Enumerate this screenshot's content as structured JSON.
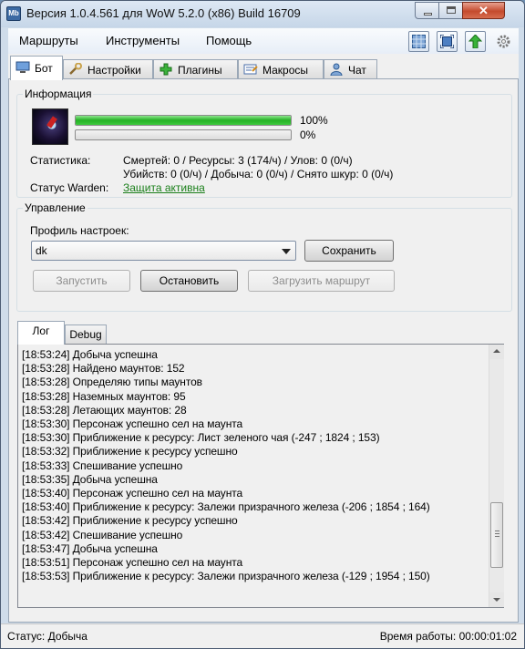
{
  "window": {
    "title": "Версия 1.0.4.561 для WoW 5.2.0 (x86) Build 16709",
    "app_icon_text": "Mb",
    "close_glyph": "✕"
  },
  "menu": {
    "items": [
      "Маршруты",
      "Инструменты",
      "Помощь"
    ],
    "toolbar_icons": [
      "grid-icon",
      "fullscreen-icon",
      "arrow-up-icon",
      "gear-icon"
    ]
  },
  "tabs": [
    {
      "label": "Бот",
      "icon": "monitor-icon",
      "active": true
    },
    {
      "label": "Настройки",
      "icon": "wrench-icon",
      "active": false
    },
    {
      "label": "Плагины",
      "icon": "plus-icon",
      "active": false
    },
    {
      "label": "Макросы",
      "icon": "macro-icon",
      "active": false
    },
    {
      "label": "Чат",
      "icon": "user-icon",
      "active": false
    }
  ],
  "info": {
    "title": "Информация",
    "bar1_value": 100,
    "bar1_label": "100%",
    "bar2_value": 0,
    "bar2_label": "0%",
    "stats_label": "Статистика:",
    "stats_line1": "Смертей: 0 / Ресурсы: 3 (174/ч) / Улов: 0 (0/ч)",
    "stats_line2": "Убийств: 0 (0/ч) / Добыча: 0 (0/ч) / Снято шкур: 0 (0/ч)",
    "warden_label": "Статус Warden:",
    "warden_status": "Защита активна",
    "warden_color": "#1a7f1a"
  },
  "control": {
    "title": "Управление",
    "profile_label": "Профиль настроек:",
    "profile_value": "dk",
    "save_label": "Сохранить",
    "start_label": "Запустить",
    "stop_label": "Остановить",
    "load_route_label": "Загрузить маршрут"
  },
  "log": {
    "tabs": [
      "Лог",
      "Debug"
    ],
    "lines": [
      "[18:53:24] Добыча успешна",
      "[18:53:28] Найдено маунтов: 152",
      "[18:53:28] Определяю типы маунтов",
      "[18:53:28] Наземных маунтов: 95",
      "[18:53:28] Летающих маунтов: 28",
      "[18:53:30] Персонаж успешно сел на маунта",
      "[18:53:30] Приближение к ресурсу: Лист зеленого чая (-247 ; 1824 ; 153)",
      "[18:53:32] Приближение к ресурсу успешно",
      "[18:53:33] Спешивание успешно",
      "[18:53:35] Добыча успешна",
      "[18:53:40] Персонаж успешно сел на маунта",
      "[18:53:40] Приближение к ресурсу: Залежи призрачного железа (-206 ; 1854 ; 164)",
      "[18:53:42] Приближение к ресурсу успешно",
      "[18:53:42] Спешивание успешно",
      "[18:53:47] Добыча успешна",
      "[18:53:51] Персонаж успешно сел на маунта",
      "[18:53:53] Приближение к ресурсу: Залежи призрачного железа (-129 ; 1954 ; 150)"
    ]
  },
  "status": {
    "left": "Статус: Добыча",
    "right": "Время работы: 00:00:01:02"
  }
}
